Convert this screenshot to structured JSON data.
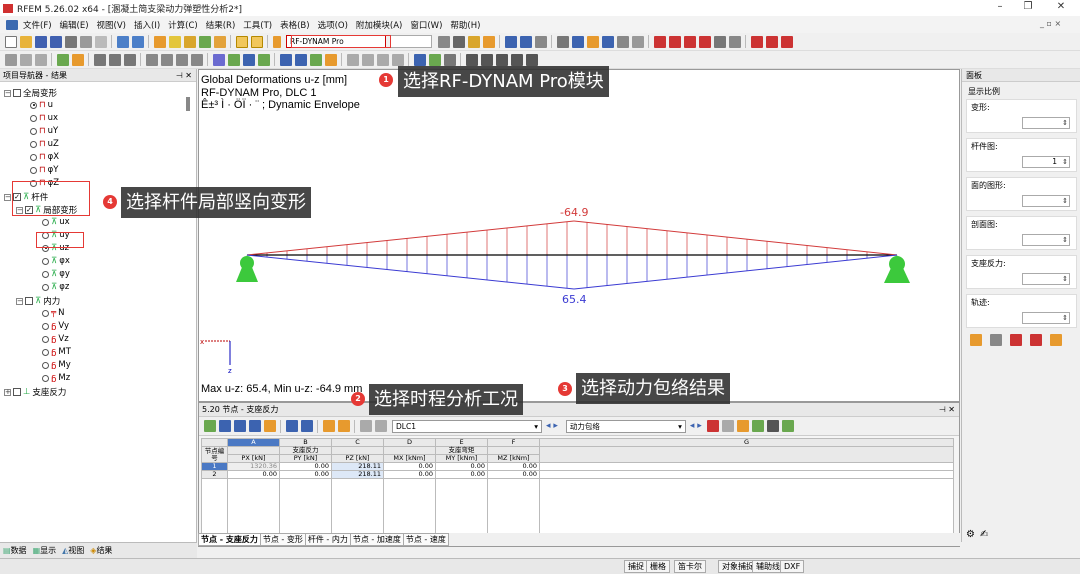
{
  "window": {
    "title": "RFEM 5.26.02 x64 - [溷凝土简支梁动力弹塑性分析2*]",
    "min": "–",
    "max": "❐",
    "close": "✕"
  },
  "menu": [
    "文件(F)",
    "编辑(E)",
    "视图(V)",
    "插入(I)",
    "计算(C)",
    "结果(R)",
    "工具(T)",
    "表格(B)",
    "选项(O)",
    "附加模块(A)",
    "窗口(W)",
    "帮助(H)"
  ],
  "mdi_controls": "_ ▫ ×",
  "toolbar": {
    "module_combo": "RF-DYNAM Pro"
  },
  "navigator": {
    "title": "项目导航器 - 结果",
    "pin": "⊣ ✕",
    "items": [
      {
        "label": "全局变形",
        "kind": "group"
      },
      {
        "label": "u"
      },
      {
        "label": "ux"
      },
      {
        "label": "uY"
      },
      {
        "label": "uZ"
      },
      {
        "label": "φX"
      },
      {
        "label": "φY"
      },
      {
        "label": "φZ"
      },
      {
        "label": "杆件",
        "kind": "group"
      },
      {
        "label": "局部变形",
        "kind": "group"
      },
      {
        "label": "ux"
      },
      {
        "label": "uy"
      },
      {
        "label": "uz"
      },
      {
        "label": "φx"
      },
      {
        "label": "φy"
      },
      {
        "label": "φz"
      },
      {
        "label": "内力",
        "kind": "group"
      },
      {
        "label": "N"
      },
      {
        "label": "Vy"
      },
      {
        "label": "Vz"
      },
      {
        "label": "MT"
      },
      {
        "label": "My"
      },
      {
        "label": "Mz"
      },
      {
        "label": "支座反力",
        "kind": "group"
      }
    ],
    "tabs": [
      "数据",
      "显示",
      "视图",
      "结果"
    ]
  },
  "view": {
    "line1": "Global Deformations u-z [mm]",
    "line2": "RF-DYNAM Pro, DLC 1",
    "line3": "Ê±³ Ì · ÖÏ    · ¨ ; Dynamic Envelope",
    "min_label": "-64.9",
    "max_label": "65.4",
    "summary": "Max u-z: 65.4, Min u-z: -64.9 mm",
    "axis_x": "x",
    "axis_z": "z",
    "colors": {
      "pos": "#d23a3a",
      "neg": "#3a3ad2",
      "support": "#3cc93c"
    }
  },
  "callouts": [
    {
      "n": "1",
      "text": "选择RF-DYNAM Pro模块"
    },
    {
      "n": "2",
      "text": "选择时程分析工况"
    },
    {
      "n": "3",
      "text": "选择动力包络结果"
    },
    {
      "n": "4",
      "text": "选择杆件局部竖向变形"
    }
  ],
  "table": {
    "title": "5.20 节点 - 支座反力",
    "pin": "⊣ ✕",
    "case": "DLC1",
    "result": "动力包络",
    "col_letters": [
      "A",
      "B",
      "C",
      "D",
      "E",
      "F",
      "G"
    ],
    "row_header": "节点编号",
    "group1": "支座反力",
    "group2": "支座弯矩",
    "units": [
      "PX [kN]",
      "PY [kN]",
      "PZ [kN]",
      "MX [kNm]",
      "MY [kNm]",
      "MZ [kNm]"
    ],
    "rows": [
      [
        "1",
        "1320.36",
        "0.00",
        "218.11",
        "0.00",
        "0.00",
        "0.00"
      ],
      [
        "2",
        "0.00",
        "0.00",
        "218.11",
        "0.00",
        "0.00",
        "0.00"
      ]
    ],
    "bottom_tabs": [
      "节点 - 支座反力",
      "节点 - 变形",
      "杆件 - 内力",
      "节点 - 加速度",
      "节点 - 速度"
    ]
  },
  "panel": {
    "title": "面板",
    "subtitle": "显示比例",
    "fields": [
      {
        "label": "变形:",
        "value": ""
      },
      {
        "label": "杆件图:",
        "value": "1"
      },
      {
        "label": "面的图形:",
        "value": ""
      },
      {
        "label": "剖面图:",
        "value": ""
      },
      {
        "label": "支座反力:",
        "value": ""
      },
      {
        "label": "轨迹:",
        "value": ""
      }
    ]
  },
  "status": [
    "捕捉",
    "栅格",
    "笛卡尔",
    "对象捕捉",
    "辅助线",
    "DXF"
  ]
}
